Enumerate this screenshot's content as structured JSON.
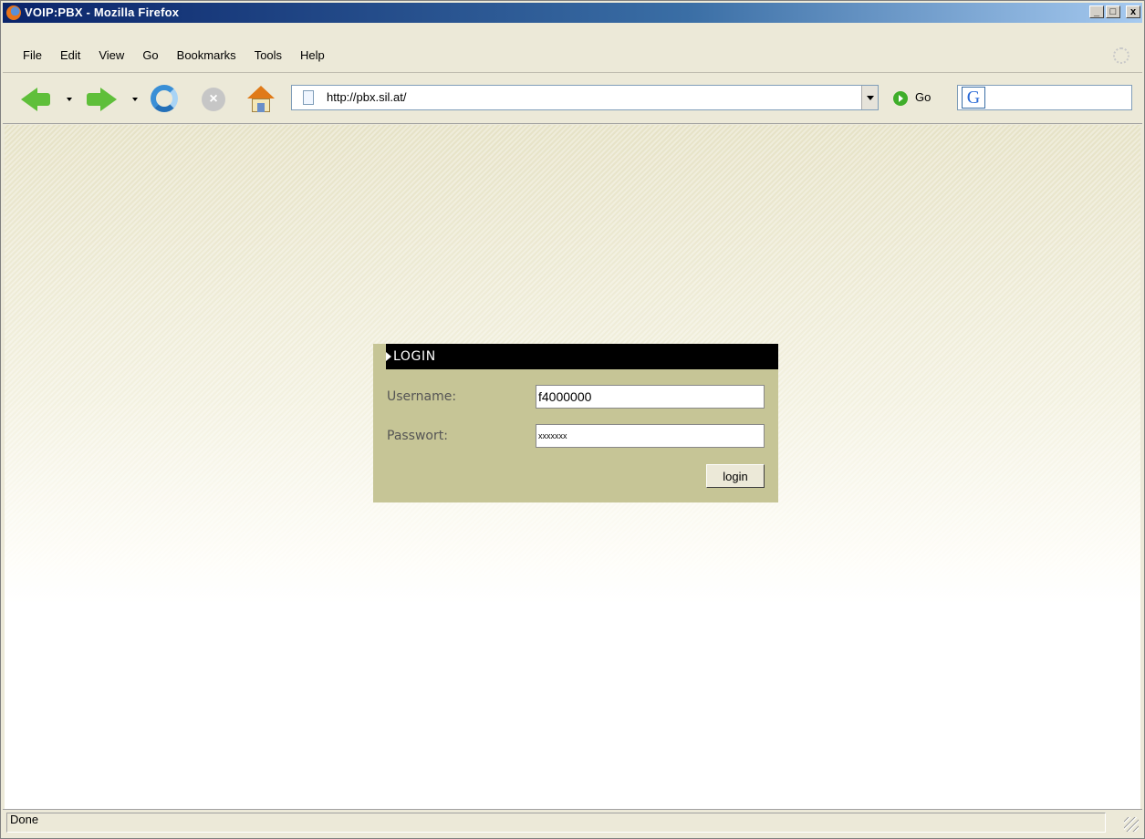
{
  "window": {
    "title": "VOIP:PBX - Mozilla Firefox",
    "minimize": "_",
    "maximize": "□",
    "close": "x"
  },
  "menu": [
    "File",
    "Edit",
    "View",
    "Go",
    "Bookmarks",
    "Tools",
    "Help"
  ],
  "toolbar": {
    "url": "http://pbx.sil.at/",
    "go_label": "Go",
    "search_logo": "G"
  },
  "login": {
    "header": "LOGIN",
    "username_label": "Username:",
    "username_value": "f4000000",
    "password_label": "Passwort:",
    "password_value": "xxxxxxx",
    "button_label": "login"
  },
  "status": {
    "text": "Done"
  },
  "colors": {
    "login_panel": "#c6c596",
    "login_header": "#000000",
    "title_bar": "#0a246a"
  }
}
